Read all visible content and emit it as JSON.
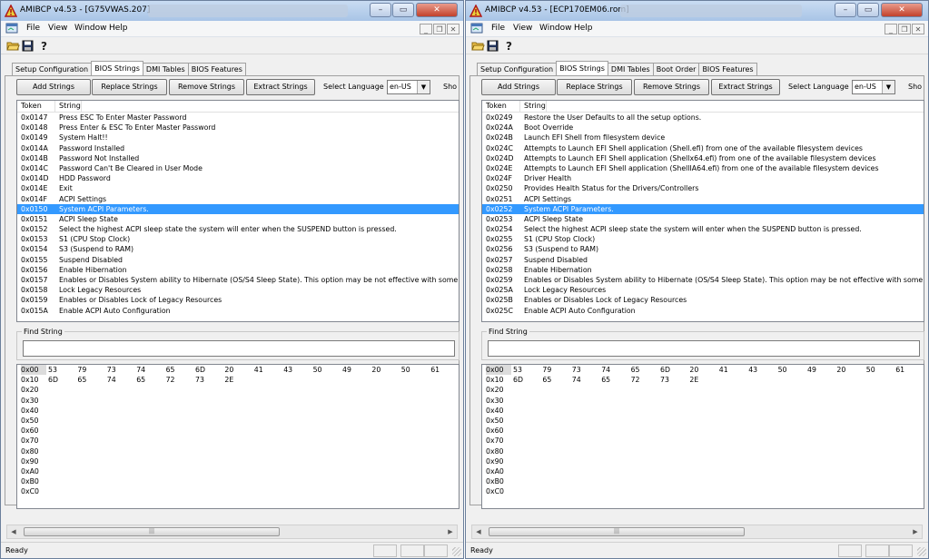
{
  "windows": [
    {
      "title": "AMIBCP v4.53 - [G75VWAS.207]",
      "menu": [
        "File",
        "View",
        "Window",
        "Help"
      ],
      "tabs": [
        {
          "label": "Setup Configuration",
          "active": false
        },
        {
          "label": "BIOS Strings",
          "active": true
        },
        {
          "label": "DMI Tables",
          "active": false
        },
        {
          "label": "BIOS Features",
          "active": false
        }
      ],
      "buttons": {
        "add": "Add Strings",
        "replace": "Replace Strings",
        "remove": "Remove Strings",
        "extract": "Extract Strings"
      },
      "language_label": "Select Language",
      "language_value": "en-US",
      "show_label": "Sho",
      "list_headers": {
        "token": "Token",
        "string": "String"
      },
      "selected_token": "0x0150",
      "rows": [
        {
          "token": "0x0147",
          "text": "Press ESC To Enter Master Password"
        },
        {
          "token": "0x0148",
          "text": "Press Enter & ESC To Enter Master Password"
        },
        {
          "token": "0x0149",
          "text": "System Halt!!"
        },
        {
          "token": "0x014A",
          "text": "Password Installed"
        },
        {
          "token": "0x014B",
          "text": "Password Not Installed"
        },
        {
          "token": "0x014C",
          "text": "Password Can't Be Cleared in User Mode"
        },
        {
          "token": "0x014D",
          "text": " HDD Password"
        },
        {
          "token": "0x014E",
          "text": "Exit"
        },
        {
          "token": "0x014F",
          "text": "ACPI Settings"
        },
        {
          "token": "0x0150",
          "text": "System ACPI Parameters."
        },
        {
          "token": "0x0151",
          "text": "ACPI Sleep State"
        },
        {
          "token": "0x0152",
          "text": "Select the highest ACPI sleep state the system will enter when the SUSPEND button is pressed."
        },
        {
          "token": "0x0153",
          "text": "S1 (CPU Stop Clock)"
        },
        {
          "token": "0x0154",
          "text": "S3 (Suspend to RAM)"
        },
        {
          "token": "0x0155",
          "text": "Suspend Disabled"
        },
        {
          "token": "0x0156",
          "text": "Enable Hibernation"
        },
        {
          "token": "0x0157",
          "text": "Enables or Disables System ability to Hibernate (OS/S4 Sleep State). This option may be not effective with some OS."
        },
        {
          "token": "0x0158",
          "text": "Lock Legacy Resources"
        },
        {
          "token": "0x0159",
          "text": "Enables or Disables Lock of Legacy Resources"
        },
        {
          "token": "0x015A",
          "text": "Enable ACPI Auto Configuration"
        }
      ],
      "find_label": "Find String",
      "status": "Ready"
    },
    {
      "title": "AMIBCP v4.53 - [ECP170EM06.rom]",
      "menu": [
        "File",
        "View",
        "Window",
        "Help"
      ],
      "tabs": [
        {
          "label": "Setup Configuration",
          "active": false
        },
        {
          "label": "BIOS Strings",
          "active": true
        },
        {
          "label": "DMI Tables",
          "active": false
        },
        {
          "label": "Boot Order",
          "active": false
        },
        {
          "label": "BIOS Features",
          "active": false
        }
      ],
      "buttons": {
        "add": "Add Strings",
        "replace": "Replace Strings",
        "remove": "Remove Strings",
        "extract": "Extract Strings"
      },
      "language_label": "Select Language",
      "language_value": "en-US",
      "show_label": "Sho",
      "list_headers": {
        "token": "Token",
        "string": "String"
      },
      "selected_token": "0x0252",
      "rows": [
        {
          "token": "0x0249",
          "text": "Restore the User Defaults to all the setup options."
        },
        {
          "token": "0x024A",
          "text": "Boot Override"
        },
        {
          "token": "0x024B",
          "text": "Launch EFI Shell from filesystem device"
        },
        {
          "token": "0x024C",
          "text": "Attempts to Launch EFI Shell application (Shell.efi) from one of the available filesystem devices"
        },
        {
          "token": "0x024D",
          "text": "Attempts to Launch EFI Shell application (Shellx64.efi) from one of the available filesystem devices"
        },
        {
          "token": "0x024E",
          "text": "Attempts to Launch EFI Shell application (ShellIA64.efi) from one of the available filesystem devices"
        },
        {
          "token": "0x024F",
          "text": "Driver Health"
        },
        {
          "token": "0x0250",
          "text": "Provides Health Status for the Drivers/Controllers"
        },
        {
          "token": "0x0251",
          "text": "ACPI Settings"
        },
        {
          "token": "0x0252",
          "text": "System ACPI Parameters."
        },
        {
          "token": "0x0253",
          "text": "ACPI Sleep State"
        },
        {
          "token": "0x0254",
          "text": "Select the highest ACPI sleep state the system will enter when the SUSPEND button is pressed."
        },
        {
          "token": "0x0255",
          "text": "S1 (CPU Stop Clock)"
        },
        {
          "token": "0x0256",
          "text": "S3 (Suspend to RAM)"
        },
        {
          "token": "0x0257",
          "text": "Suspend Disabled"
        },
        {
          "token": "0x0258",
          "text": "Enable Hibernation"
        },
        {
          "token": "0x0259",
          "text": "Enables or Disables System ability to Hibernate (OS/S4 Sleep State). This option may be not effective with some OS."
        },
        {
          "token": "0x025A",
          "text": "Lock Legacy Resources"
        },
        {
          "token": "0x025B",
          "text": "Enables or Disables Lock of Legacy Resources"
        },
        {
          "token": "0x025C",
          "text": "Enable ACPI Auto Configuration"
        }
      ],
      "find_label": "Find String",
      "status": "Ready"
    }
  ],
  "hex": {
    "offsets": [
      "0x00",
      "0x10",
      "0x20",
      "0x30",
      "0x40",
      "0x50",
      "0x60",
      "0x70",
      "0x80",
      "0x90",
      "0xA0",
      "0xB0",
      "0xC0"
    ],
    "rows": [
      [
        "53",
        "79",
        "73",
        "74",
        "65",
        "6D",
        "20",
        "41",
        "43",
        "50",
        "49",
        "20",
        "50",
        "61"
      ],
      [
        "6D",
        "65",
        "74",
        "65",
        "72",
        "73",
        "2E"
      ]
    ]
  },
  "colors": {
    "selection": "#3399ff",
    "title_gradient_top": "#c9dcf2",
    "title_gradient_bottom": "#a8c4e6"
  }
}
